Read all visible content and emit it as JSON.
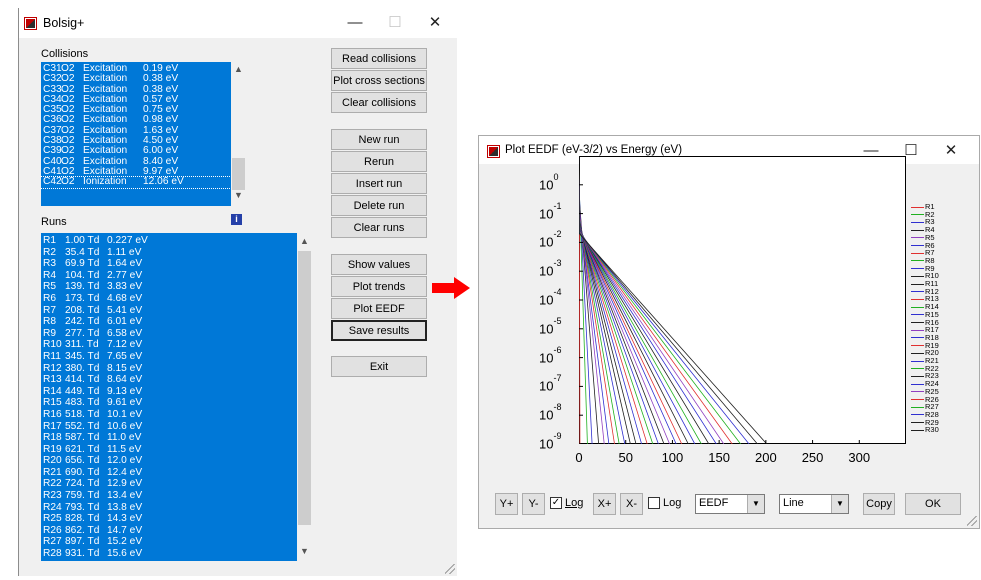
{
  "main_window": {
    "title": "Bolsig+",
    "collisions_label": "Collisions",
    "runs_label": "Runs",
    "collisions": [
      {
        "id": "C31",
        "species": "O2",
        "type": "Excitation",
        "energy": "0.19 eV"
      },
      {
        "id": "C32",
        "species": "O2",
        "type": "Excitation",
        "energy": "0.38 eV"
      },
      {
        "id": "C33",
        "species": "O2",
        "type": "Excitation",
        "energy": "0.38 eV"
      },
      {
        "id": "C34",
        "species": "O2",
        "type": "Excitation",
        "energy": "0.57 eV"
      },
      {
        "id": "C35",
        "species": "O2",
        "type": "Excitation",
        "energy": "0.75 eV"
      },
      {
        "id": "C36",
        "species": "O2",
        "type": "Excitation",
        "energy": "0.98 eV"
      },
      {
        "id": "C37",
        "species": "O2",
        "type": "Excitation",
        "energy": "1.63 eV"
      },
      {
        "id": "C38",
        "species": "O2",
        "type": "Excitation",
        "energy": "4.50 eV"
      },
      {
        "id": "C39",
        "species": "O2",
        "type": "Excitation",
        "energy": "6.00 eV"
      },
      {
        "id": "C40",
        "species": "O2",
        "type": "Excitation",
        "energy": "8.40 eV"
      },
      {
        "id": "C41",
        "species": "O2",
        "type": "Excitation",
        "energy": "9.97 eV"
      },
      {
        "id": "C42",
        "species": "O2",
        "type": "Ionization",
        "energy": "12.06 eV"
      }
    ],
    "runs": [
      {
        "id": "R1",
        "field": "1.00 Td",
        "energy": "0.227 eV"
      },
      {
        "id": "R2",
        "field": "35.4 Td",
        "energy": "1.11 eV"
      },
      {
        "id": "R3",
        "field": "69.9 Td",
        "energy": "1.64 eV"
      },
      {
        "id": "R4",
        "field": "104. Td",
        "energy": "2.77 eV"
      },
      {
        "id": "R5",
        "field": "139. Td",
        "energy": "3.83 eV"
      },
      {
        "id": "R6",
        "field": "173. Td",
        "energy": "4.68 eV"
      },
      {
        "id": "R7",
        "field": "208. Td",
        "energy": "5.41 eV"
      },
      {
        "id": "R8",
        "field": "242. Td",
        "energy": "6.01 eV"
      },
      {
        "id": "R9",
        "field": "277. Td",
        "energy": "6.58 eV"
      },
      {
        "id": "R10",
        "field": "311. Td",
        "energy": "7.12 eV"
      },
      {
        "id": "R11",
        "field": "345. Td",
        "energy": "7.65 eV"
      },
      {
        "id": "R12",
        "field": "380. Td",
        "energy": "8.15 eV"
      },
      {
        "id": "R13",
        "field": "414. Td",
        "energy": "8.64 eV"
      },
      {
        "id": "R14",
        "field": "449. Td",
        "energy": "9.13 eV"
      },
      {
        "id": "R15",
        "field": "483. Td",
        "energy": "9.61 eV"
      },
      {
        "id": "R16",
        "field": "518. Td",
        "energy": "10.1 eV"
      },
      {
        "id": "R17",
        "field": "552. Td",
        "energy": "10.6 eV"
      },
      {
        "id": "R18",
        "field": "587. Td",
        "energy": "11.0 eV"
      },
      {
        "id": "R19",
        "field": "621. Td",
        "energy": "11.5 eV"
      },
      {
        "id": "R20",
        "field": "656. Td",
        "energy": "12.0 eV"
      },
      {
        "id": "R21",
        "field": "690. Td",
        "energy": "12.4 eV"
      },
      {
        "id": "R22",
        "field": "724. Td",
        "energy": "12.9 eV"
      },
      {
        "id": "R23",
        "field": "759. Td",
        "energy": "13.4 eV"
      },
      {
        "id": "R24",
        "field": "793. Td",
        "energy": "13.8 eV"
      },
      {
        "id": "R25",
        "field": "828. Td",
        "energy": "14.3 eV"
      },
      {
        "id": "R26",
        "field": "862. Td",
        "energy": "14.7 eV"
      },
      {
        "id": "R27",
        "field": "897. Td",
        "energy": "15.2 eV"
      },
      {
        "id": "R28",
        "field": "931. Td",
        "energy": "15.6 eV"
      }
    ],
    "buttons": {
      "read_collisions": "Read collisions",
      "plot_cross_sections": "Plot cross sections",
      "clear_collisions": "Clear collisions",
      "new_run": "New run",
      "rerun": "Rerun",
      "insert_run": "Insert run",
      "delete_run": "Delete run",
      "clear_runs": "Clear runs",
      "show_values": "Show values",
      "plot_trends": "Plot trends",
      "plot_eedf": "Plot EEDF",
      "save_results": "Save results",
      "exit": "Exit"
    },
    "info_icon": "i"
  },
  "plot_window": {
    "title": "Plot EEDF (eV-3/2)  vs  Energy (eV)",
    "toolbar": {
      "y_plus": "Y+",
      "y_minus": "Y-",
      "y_log_checked": "✓",
      "y_log": "Log",
      "x_plus": "X+",
      "x_minus": "X-",
      "x_log_checked": "",
      "x_log": "Log",
      "quantity": "EEDF",
      "style": "Line",
      "copy": "Copy",
      "ok": "OK"
    }
  },
  "chart_data": {
    "type": "line",
    "title": "Plot EEDF (eV-3/2)  vs  Energy (eV)",
    "xlabel": "",
    "ylabel": "",
    "xlim": [
      0,
      350
    ],
    "ylim": [
      1e-09,
      10
    ],
    "log_y": true,
    "x_ticks": [
      "0",
      "50",
      "100",
      "150",
      "200",
      "250",
      "300"
    ],
    "y_ticks": [
      {
        "base": "10",
        "exp": "0"
      },
      {
        "base": "10",
        "exp": "-1"
      },
      {
        "base": "10",
        "exp": "-2"
      },
      {
        "base": "10",
        "exp": "-3"
      },
      {
        "base": "10",
        "exp": "-4"
      },
      {
        "base": "10",
        "exp": "-5"
      },
      {
        "base": "10",
        "exp": "-6"
      },
      {
        "base": "10",
        "exp": "-7"
      },
      {
        "base": "10",
        "exp": "-8"
      },
      {
        "base": "10",
        "exp": "-9"
      }
    ],
    "legend_position": "right",
    "series": [
      {
        "name": "R1",
        "color": "#e03030",
        "start": 0.7,
        "end_x": 1
      },
      {
        "name": "R2",
        "color": "#20b020",
        "start": 0.7,
        "end_x": 9
      },
      {
        "name": "R3",
        "color": "#3030d0",
        "start": 0.5,
        "end_x": 14
      },
      {
        "name": "R4",
        "color": "#202020",
        "start": 0.3,
        "end_x": 21
      },
      {
        "name": "R5",
        "color": "#9040c0",
        "start": 0.15,
        "end_x": 27
      },
      {
        "name": "R6",
        "color": "#3030d0",
        "start": 0.1,
        "end_x": 32
      },
      {
        "name": "R7",
        "color": "#e03030",
        "start": 0.08,
        "end_x": 38
      },
      {
        "name": "R8",
        "color": "#20b020",
        "start": 0.07,
        "end_x": 43
      },
      {
        "name": "R9",
        "color": "#3030d0",
        "start": 0.06,
        "end_x": 49
      },
      {
        "name": "R10",
        "color": "#202020",
        "start": 0.055,
        "end_x": 55
      },
      {
        "name": "R11",
        "color": "#202020",
        "start": 0.05,
        "end_x": 61
      },
      {
        "name": "R12",
        "color": "#3030d0",
        "start": 0.045,
        "end_x": 67
      },
      {
        "name": "R13",
        "color": "#e03030",
        "start": 0.042,
        "end_x": 73
      },
      {
        "name": "R14",
        "color": "#20b020",
        "start": 0.04,
        "end_x": 79
      },
      {
        "name": "R15",
        "color": "#3030d0",
        "start": 0.038,
        "end_x": 85
      },
      {
        "name": "R16",
        "color": "#202020",
        "start": 0.036,
        "end_x": 91
      },
      {
        "name": "R17",
        "color": "#9040c0",
        "start": 0.034,
        "end_x": 97
      },
      {
        "name": "R18",
        "color": "#3030d0",
        "start": 0.032,
        "end_x": 104
      },
      {
        "name": "R19",
        "color": "#e03030",
        "start": 0.031,
        "end_x": 110
      },
      {
        "name": "R20",
        "color": "#202020",
        "start": 0.03,
        "end_x": 117
      },
      {
        "name": "R21",
        "color": "#3030d0",
        "start": 0.029,
        "end_x": 124
      },
      {
        "name": "R22",
        "color": "#20b020",
        "start": 0.028,
        "end_x": 131
      },
      {
        "name": "R23",
        "color": "#202020",
        "start": 0.027,
        "end_x": 139
      },
      {
        "name": "R24",
        "color": "#3030d0",
        "start": 0.026,
        "end_x": 147
      },
      {
        "name": "R25",
        "color": "#9040c0",
        "start": 0.025,
        "end_x": 155
      },
      {
        "name": "R26",
        "color": "#e03030",
        "start": 0.024,
        "end_x": 164
      },
      {
        "name": "R27",
        "color": "#20b020",
        "start": 0.023,
        "end_x": 173
      },
      {
        "name": "R28",
        "color": "#3030d0",
        "start": 0.022,
        "end_x": 182
      },
      {
        "name": "R29",
        "color": "#202020",
        "start": 0.021,
        "end_x": 191
      },
      {
        "name": "R30",
        "color": "#202020",
        "start": 0.02,
        "end_x": 201
      }
    ]
  },
  "colors": {
    "selection": "#0078d7",
    "arrow": "#ff0000",
    "button_face": "#e1e1e1",
    "dialog": "#f0f0f0"
  }
}
